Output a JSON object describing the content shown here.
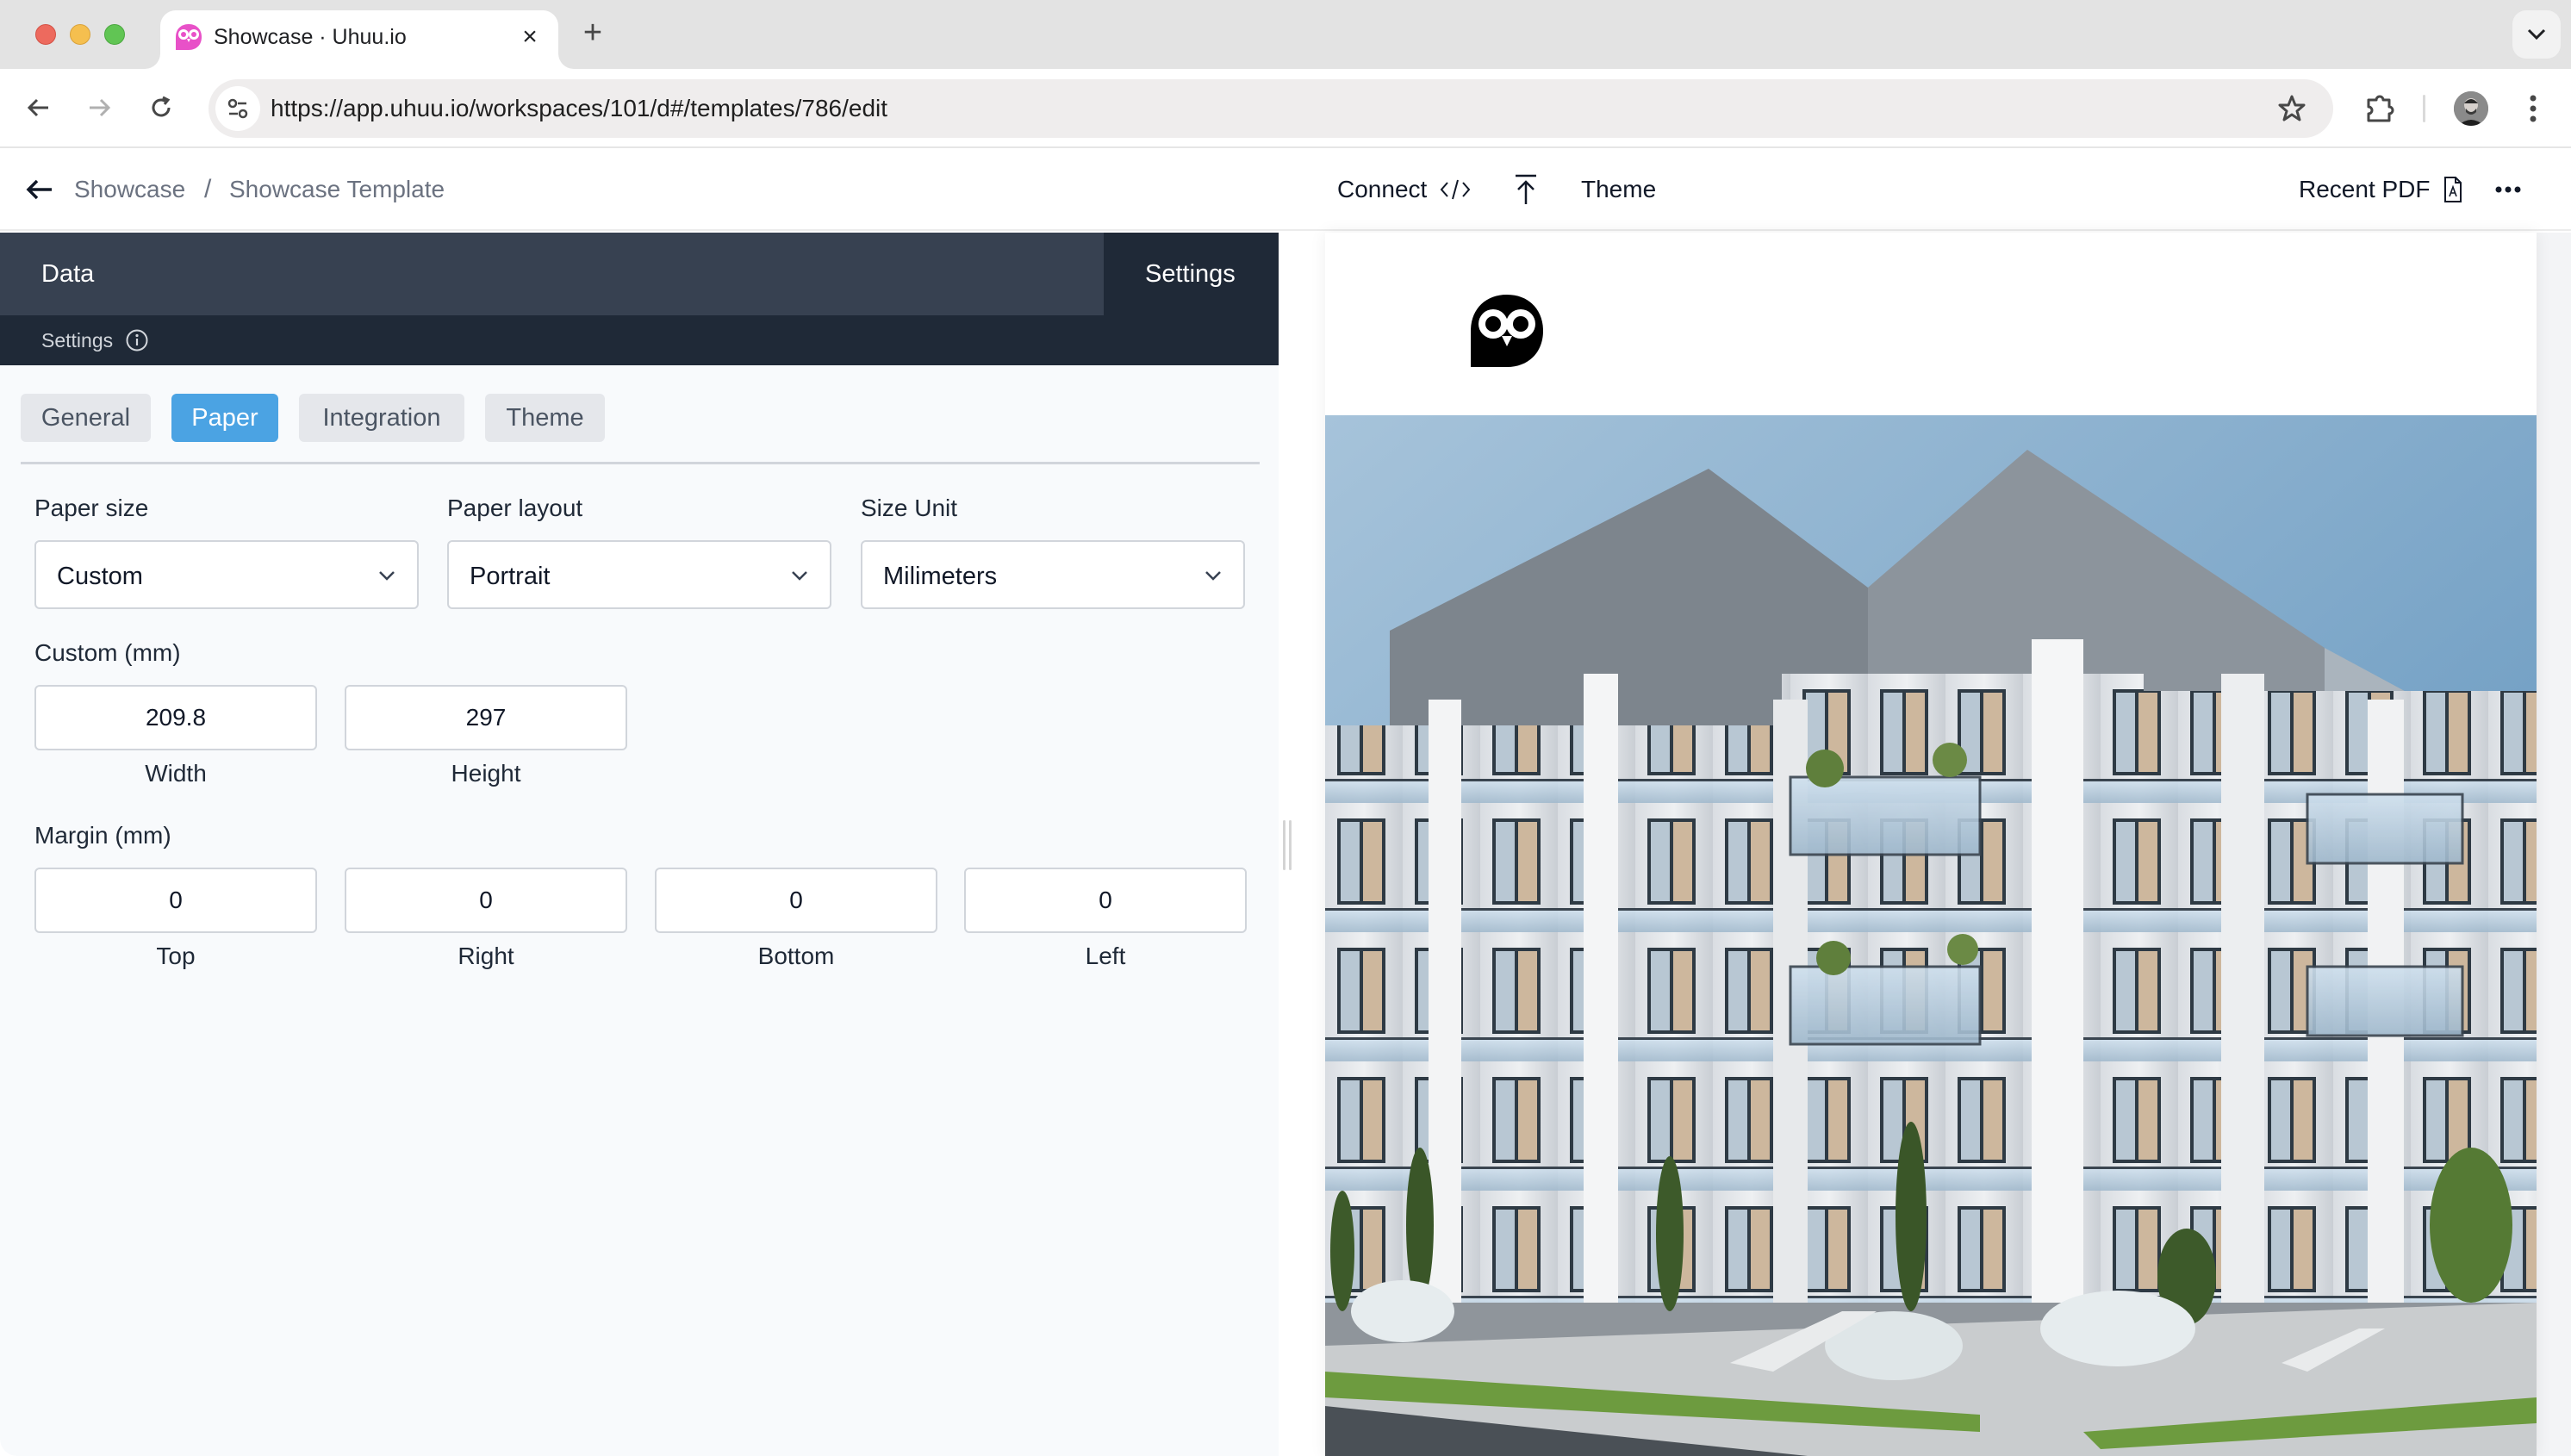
{
  "browser": {
    "tab_title": "Showcase · Uhuu.io",
    "tab_close": "×",
    "new_tab": "+",
    "url": "https://app.uhuu.io/workspaces/101/d#/templates/786/edit",
    "favicon_color": "#e851c8"
  },
  "header": {
    "breadcrumb": [
      {
        "label": "Showcase"
      },
      {
        "label": "Showcase Template"
      }
    ],
    "breadcrumb_separator": "/",
    "connect_label": "Connect",
    "theme_label": "Theme",
    "recent_pdf_label": "Recent PDF"
  },
  "panel": {
    "tabs": [
      {
        "label": "Data",
        "active": false
      },
      {
        "label": "Settings",
        "active": true
      }
    ],
    "subheader": "Settings",
    "settings_tabs": [
      {
        "label": "General",
        "active": false
      },
      {
        "label": "Paper",
        "active": true
      },
      {
        "label": "Integration",
        "active": false
      },
      {
        "label": "Theme",
        "active": false
      }
    ],
    "accent_color": "#4ba3e3",
    "paper_size": {
      "label": "Paper size",
      "value": "Custom"
    },
    "paper_layout": {
      "label": "Paper layout",
      "value": "Portrait"
    },
    "size_unit": {
      "label": "Size Unit",
      "value": "Milimeters"
    },
    "custom": {
      "label": "Custom (mm)",
      "width": {
        "label": "Width",
        "value": "209.8"
      },
      "height": {
        "label": "Height",
        "value": "297"
      }
    },
    "margin": {
      "label": "Margin (mm)",
      "top": {
        "label": "Top",
        "value": "0"
      },
      "right": {
        "label": "Right",
        "value": "0"
      },
      "bottom": {
        "label": "Bottom",
        "value": "0"
      },
      "left": {
        "label": "Left",
        "value": "0"
      }
    }
  },
  "preview": {
    "logo": "uhuu-owl-logo",
    "image": "modern-apartment-building-photo"
  }
}
